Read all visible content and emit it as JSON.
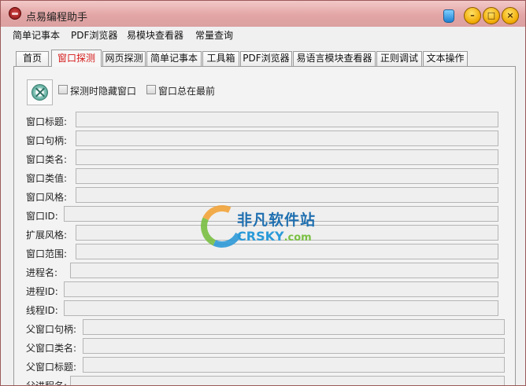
{
  "window": {
    "title": "点易编程助手"
  },
  "menu": [
    "简单记事本",
    "PDF浏览器",
    "易模块查看器",
    "常量查询"
  ],
  "tabs": [
    {
      "label": "首页",
      "active": false
    },
    {
      "label": "窗口探测",
      "active": true
    },
    {
      "label": "网页探测",
      "active": false
    },
    {
      "label": "简单记事本",
      "active": false
    },
    {
      "label": "工具箱",
      "active": false
    },
    {
      "label": "PDF浏览器",
      "active": false
    },
    {
      "label": "易语言模块查看器",
      "active": false
    },
    {
      "label": "正则调试",
      "active": false
    },
    {
      "label": "文本操作",
      "active": false
    }
  ],
  "options": {
    "hide_on_probe": {
      "label": "探测时隐藏窗口",
      "checked": false
    },
    "always_on_top": {
      "label": "窗口总在最前",
      "checked": false
    }
  },
  "fields": [
    {
      "label": "窗口标题:",
      "value": ""
    },
    {
      "label": "窗口句柄:",
      "value": ""
    },
    {
      "label": "窗口类名:",
      "value": ""
    },
    {
      "label": "窗口类值:",
      "value": ""
    },
    {
      "label": "窗口风格:",
      "value": ""
    },
    {
      "label": "窗口ID:",
      "value": ""
    },
    {
      "label": "扩展风格:",
      "value": ""
    },
    {
      "label": "窗口范围:",
      "value": ""
    },
    {
      "label": "进程名:",
      "value": ""
    },
    {
      "label": "进程ID:",
      "value": ""
    },
    {
      "label": "线程ID:",
      "value": ""
    },
    {
      "label": "父窗口句柄:",
      "value": ""
    },
    {
      "label": "父窗口类名:",
      "value": ""
    },
    {
      "label": "父窗口标题:",
      "value": ""
    },
    {
      "label": "父进程名:",
      "value": ""
    }
  ],
  "watermark": {
    "cn": "非凡软件站",
    "en": "CRSKY",
    "en_suffix": ".com"
  }
}
